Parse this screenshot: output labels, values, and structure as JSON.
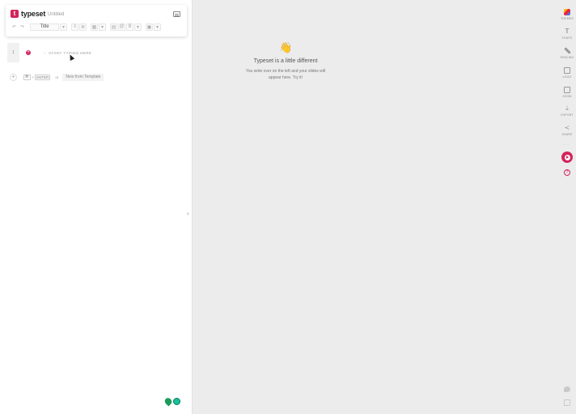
{
  "app": {
    "logo_mark": "t",
    "name": "typeset",
    "doc_title": "Untitled"
  },
  "toolbar": {
    "undo": "↶",
    "redo": "↷",
    "style_value": "Title",
    "dropdown": "▾",
    "bullet_list": "≡",
    "numbered_list": "≣",
    "grid": "▦",
    "align": "▤",
    "link": "@",
    "bold": "B",
    "image": "▣"
  },
  "editor": {
    "line_number": "1",
    "add_block": "+",
    "heading_marker": "+",
    "placeholder": "START TYPING HERE",
    "hint_plus": "+",
    "hint_key_cmd": "⌘",
    "hint_key_plus": "+",
    "hint_key_enter": "ENTER",
    "hint_or": "or",
    "template_button": "New from Template"
  },
  "preview": {
    "emoji": "👋",
    "heading": "Typeset is a little different",
    "line1": "You write over on the left and your slides will",
    "line2": "appear here. Try it!"
  },
  "sidebar": {
    "items": [
      {
        "label": "THEMES"
      },
      {
        "label": "FONTS"
      },
      {
        "label": "SPACING"
      },
      {
        "label": "LOGO"
      },
      {
        "label": "ZOOM"
      },
      {
        "label": "EXPORT"
      },
      {
        "label": "SHARE"
      }
    ],
    "dots": "···",
    "help": "?"
  },
  "colors": {
    "brand": "#d2245b",
    "panel_bg": "#ffffff",
    "preview_bg": "#ececec"
  }
}
